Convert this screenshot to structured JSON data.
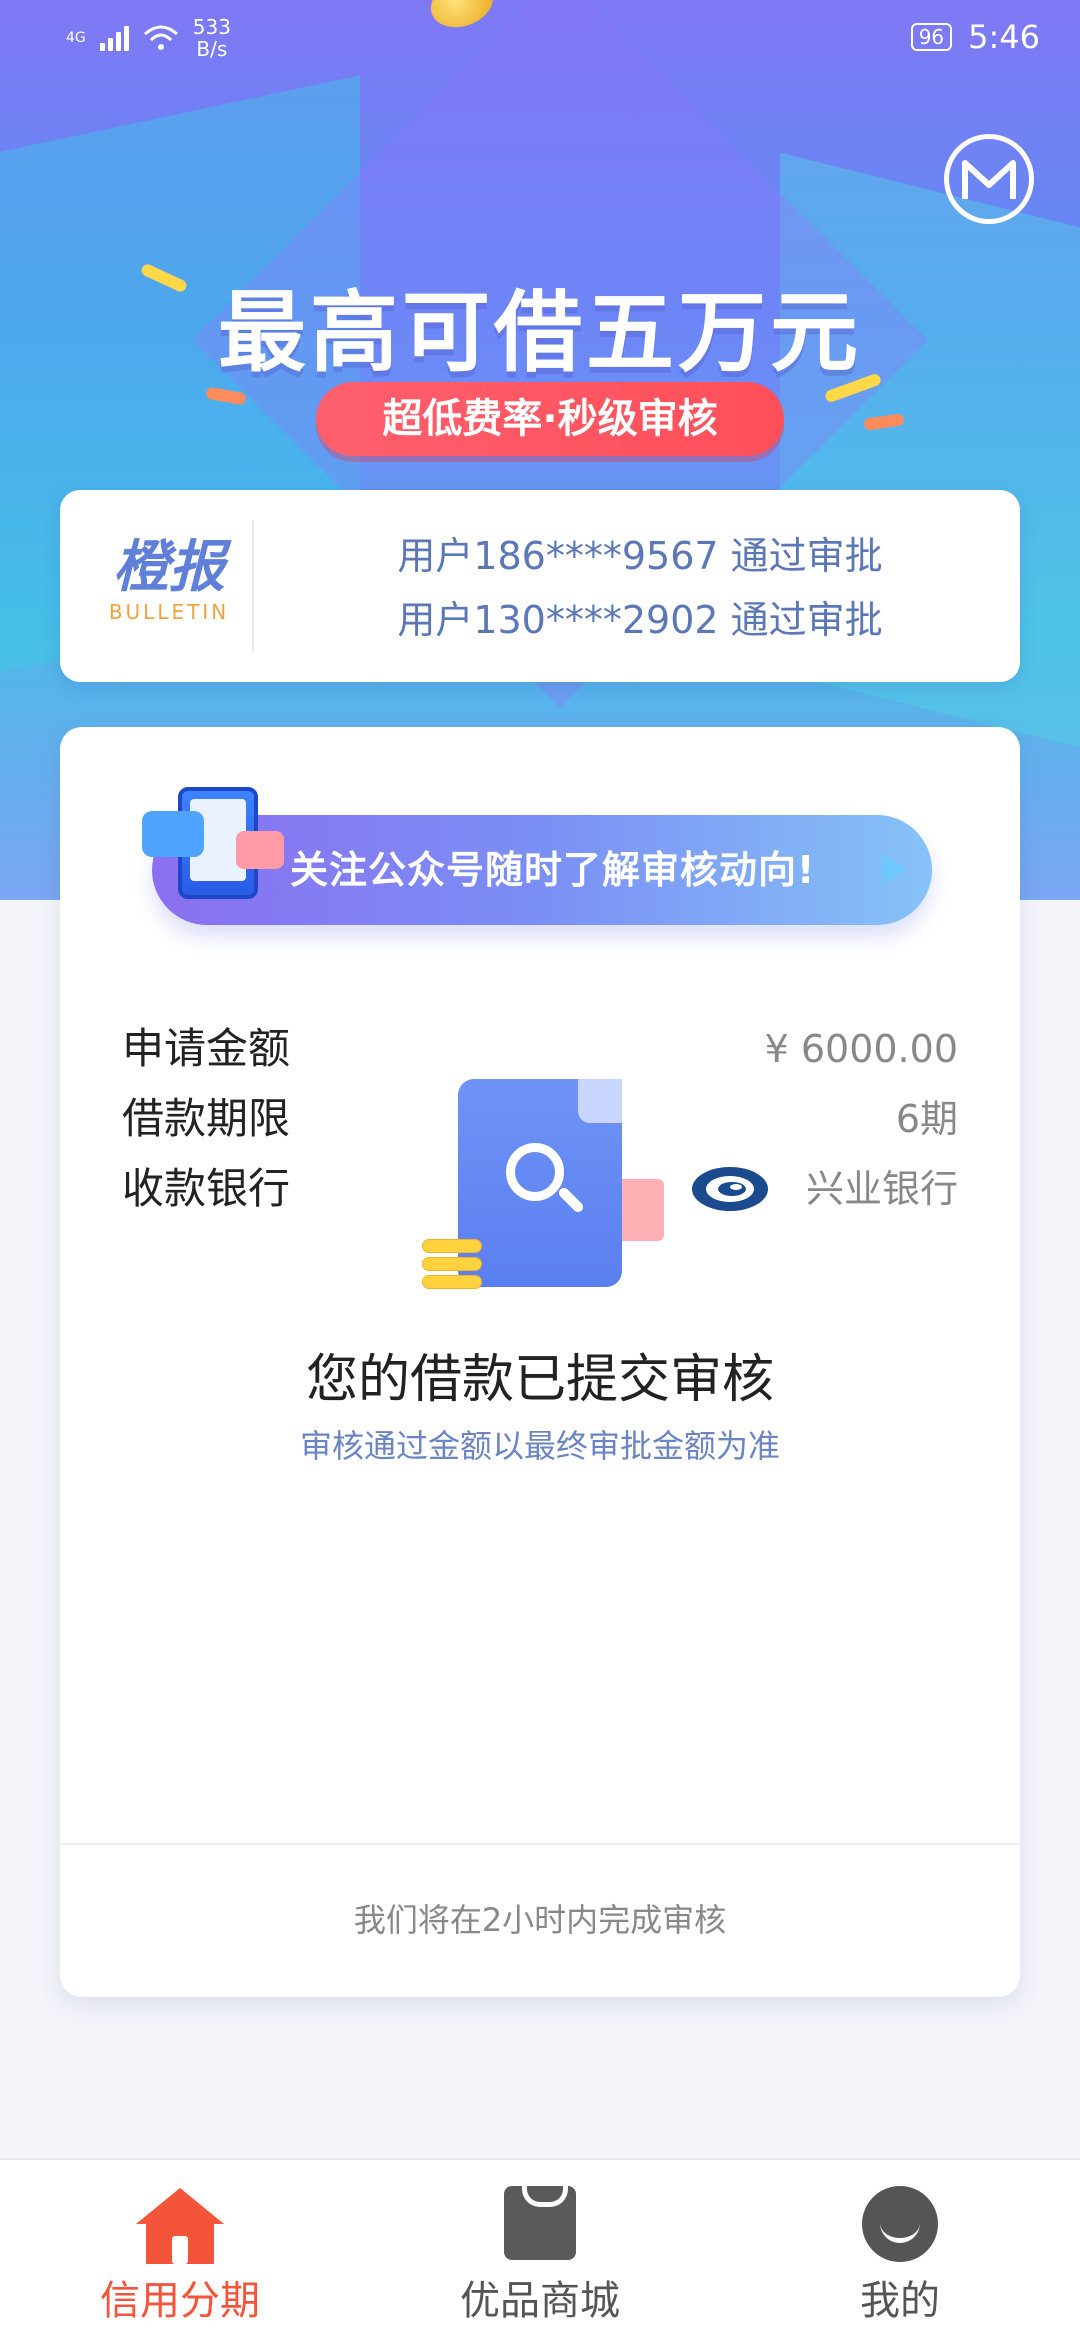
{
  "status_bar": {
    "network": "4G",
    "net_speed_value": "533",
    "net_speed_unit": "B/s",
    "battery": "96",
    "time": "5:46"
  },
  "hero": {
    "headline": "最高可借五万元",
    "tagline": "超低费率·秒级审核"
  },
  "bulletin": {
    "brand_main": "橙报",
    "brand_sub": "BULLETIN",
    "lines": [
      "用户186****9567 通过审批",
      "用户130****2902 通过审批"
    ]
  },
  "card": {
    "follow_banner": "关注公众号随时了解审核动向!",
    "submitted_title": "您的借款已提交审核",
    "submitted_hint": "审核通过金额以最终审批金额为准",
    "details": [
      {
        "label": "申请金额",
        "value": "¥ 6000.00"
      },
      {
        "label": "借款期限",
        "value": "6期"
      },
      {
        "label": "收款银行",
        "value": "兴业银行",
        "icon": "bank-logo-icon"
      }
    ],
    "footer_note": "我们将在2小时内完成审核"
  },
  "nav": {
    "tabs": [
      {
        "label": "信用分期",
        "icon": "home-icon",
        "active": true
      },
      {
        "label": "优品商城",
        "icon": "shopping-bag-icon",
        "active": false
      },
      {
        "label": "我的",
        "icon": "profile-icon",
        "active": false
      }
    ],
    "active_color": "#f4553a",
    "inactive_color": "#555555"
  }
}
